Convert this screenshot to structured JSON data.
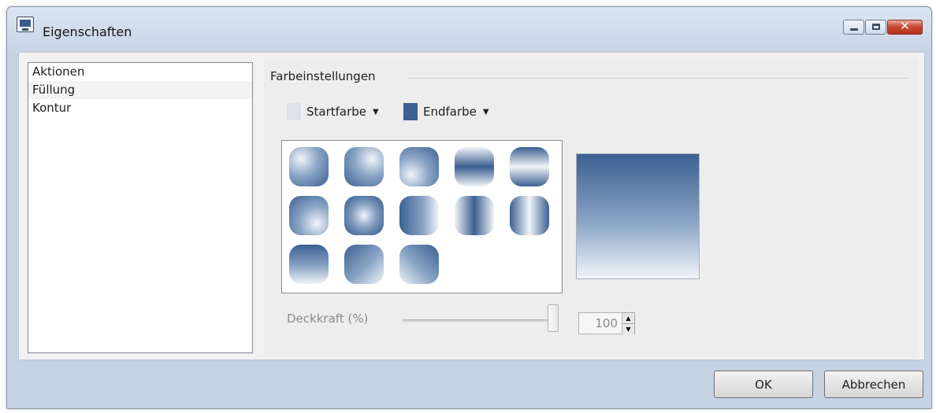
{
  "window": {
    "title": "Eigenschaften",
    "close_glyph": "✕"
  },
  "sidebar": {
    "items": [
      {
        "label": "Aktionen"
      },
      {
        "label": "Füllung",
        "selected": true
      },
      {
        "label": "Kontur"
      }
    ]
  },
  "fill": {
    "group_title": "Farbeinstellungen",
    "start_color": {
      "label": "Startfarbe",
      "color": "#dde2e8",
      "arrow": "▼"
    },
    "end_color": {
      "label": "Endfarbe",
      "color": "#3c6091",
      "arrow": "▼"
    },
    "presets_count": 13,
    "opacity": {
      "label": "Deckkraft (%)",
      "value": "100",
      "up": "▲",
      "down": "▼"
    }
  },
  "footer": {
    "ok_label": "OK",
    "cancel_label": "Abbrechen"
  },
  "colors": {
    "accent_blue": "#3c6091",
    "light": "#f1f4f8"
  }
}
